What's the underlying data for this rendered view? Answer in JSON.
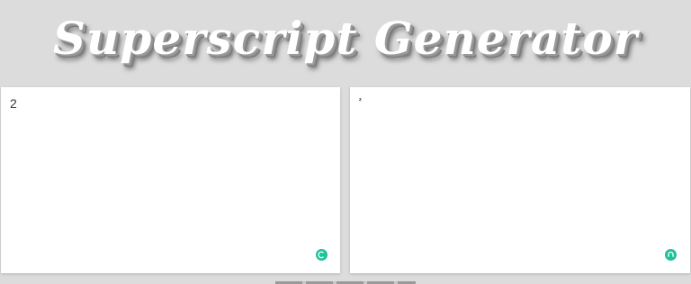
{
  "header": {
    "title": "Superscript Generator"
  },
  "input_panel": {
    "value": "2",
    "action_icon": "clear-icon"
  },
  "output_panel": {
    "value": "²",
    "action_icon": "copy-icon"
  },
  "colors": {
    "background": "#dcdcdc",
    "accent": "#1fc19a",
    "panel": "#ffffff"
  }
}
